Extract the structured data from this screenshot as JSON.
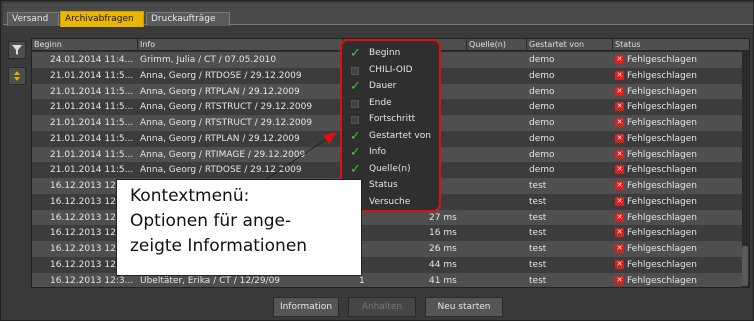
{
  "tabs": [
    {
      "label": "Versand",
      "active": false
    },
    {
      "label": "Archivabfragen",
      "active": true
    },
    {
      "label": "Druckaufträge",
      "active": false
    }
  ],
  "tools": {
    "filter_icon": "filter-icon",
    "toggle_icon": "sort-icon"
  },
  "columns": [
    {
      "label": "Beginn"
    },
    {
      "label": "Info"
    },
    {
      "label": ""
    },
    {
      "label": "Quelle(n)"
    },
    {
      "label": "Gestartet von"
    },
    {
      "label": "Status"
    }
  ],
  "rows": [
    {
      "beginn": "24.01.2014 11:4...",
      "info": "Grimm, Julia / CT / 07.05.2010",
      "dauer": "",
      "quelle": "",
      "gestartet": "demo",
      "status": "Fehlgeschlagen"
    },
    {
      "beginn": "21.01.2014 11:5...",
      "info": "Anna, Georg / RTDOSE / 29.12.2009",
      "dauer": "",
      "quelle": "",
      "gestartet": "demo",
      "status": "Fehlgeschlagen"
    },
    {
      "beginn": "21.01.2014 11:5...",
      "info": "Anna, Georg / RTPLAN / 29.12.2009",
      "dauer": "",
      "quelle": "",
      "gestartet": "demo",
      "status": "Fehlgeschlagen"
    },
    {
      "beginn": "21.01.2014 11:5...",
      "info": "Anna, Georg / RTSTRUCT / 29.12.2009",
      "dauer": "",
      "quelle": "",
      "gestartet": "demo",
      "status": "Fehlgeschlagen"
    },
    {
      "beginn": "21.01.2014 11:5...",
      "info": "Anna, Georg / RTSTRUCT / 29.12.2009",
      "dauer": "",
      "quelle": "",
      "gestartet": "demo",
      "status": "Fehlgeschlagen"
    },
    {
      "beginn": "21.01.2014 11:5...",
      "info": "Anna, Georg / RTPLAN / 29.12.2009",
      "dauer": "",
      "quelle": "",
      "gestartet": "demo",
      "status": "Fehlgeschlagen"
    },
    {
      "beginn": "21.01.2014 11:5...",
      "info": "Anna, Georg / RTIMAGE / 29.12.2009",
      "dauer": "",
      "quelle": "",
      "gestartet": "demo",
      "status": "Fehlgeschlagen"
    },
    {
      "beginn": "21.01.2014 11:5...",
      "info": "Anna, Georg / RTDOSE / 29.12.2009",
      "dauer": "",
      "quelle": "",
      "gestartet": "demo",
      "status": "Fehlgeschlagen"
    },
    {
      "beginn": "16.12.2013 12",
      "info": "",
      "dauer": "",
      "quelle": "",
      "gestartet": "test",
      "status": "Fehlgeschlagen"
    },
    {
      "beginn": "16.12.2013 12",
      "info": "",
      "dauer": "",
      "quelle": "",
      "gestartet": "test",
      "status": "Fehlgeschlagen"
    },
    {
      "beginn": "16.12.2013 12",
      "info": "",
      "dauer": "27 ms",
      "quelle": "",
      "gestartet": "test",
      "status": "Fehlgeschlagen"
    },
    {
      "beginn": "16.12.2013 12",
      "info": "",
      "dauer": "16 ms",
      "quelle": "",
      "gestartet": "test",
      "status": "Fehlgeschlagen"
    },
    {
      "beginn": "16.12.2013 12",
      "info": "",
      "dauer": "26 ms",
      "quelle": "",
      "gestartet": "test",
      "status": "Fehlgeschlagen"
    },
    {
      "beginn": "16.12.2013 12",
      "info": "",
      "dauer": "44 ms",
      "quelle": "",
      "gestartet": "test",
      "status": "Fehlgeschlagen"
    },
    {
      "beginn": "16.12.2013 12:3...",
      "info": "Übeltäter, Erika / CT / 12/29/09",
      "dauer": "41 ms",
      "quelle": "1",
      "gestartet": "test",
      "status": "Fehlgeschlagen"
    }
  ],
  "context_menu": {
    "items": [
      {
        "label": "Beginn",
        "checked": true
      },
      {
        "label": "CHILI-OID",
        "checked": false
      },
      {
        "label": "Dauer",
        "checked": true
      },
      {
        "label": "Ende",
        "checked": false
      },
      {
        "label": "Fortschritt",
        "checked": false
      },
      {
        "label": "Gestartet von",
        "checked": true
      },
      {
        "label": "Info",
        "checked": true
      },
      {
        "label": "Quelle(n)",
        "checked": true
      },
      {
        "label": "Status",
        "checked": true
      },
      {
        "label": "Versuche",
        "checked": false
      }
    ]
  },
  "callout": {
    "line1": "Kontextmenü:",
    "line2": "Optionen für ange-",
    "line3": "zeigte Informationen"
  },
  "footer": {
    "information": "Information",
    "anhalten": "Anhalten",
    "neu_starten": "Neu starten"
  },
  "colors": {
    "accent": "#eab700",
    "error": "#d8231c",
    "check": "#39c44a",
    "highlight": "#e01010"
  }
}
